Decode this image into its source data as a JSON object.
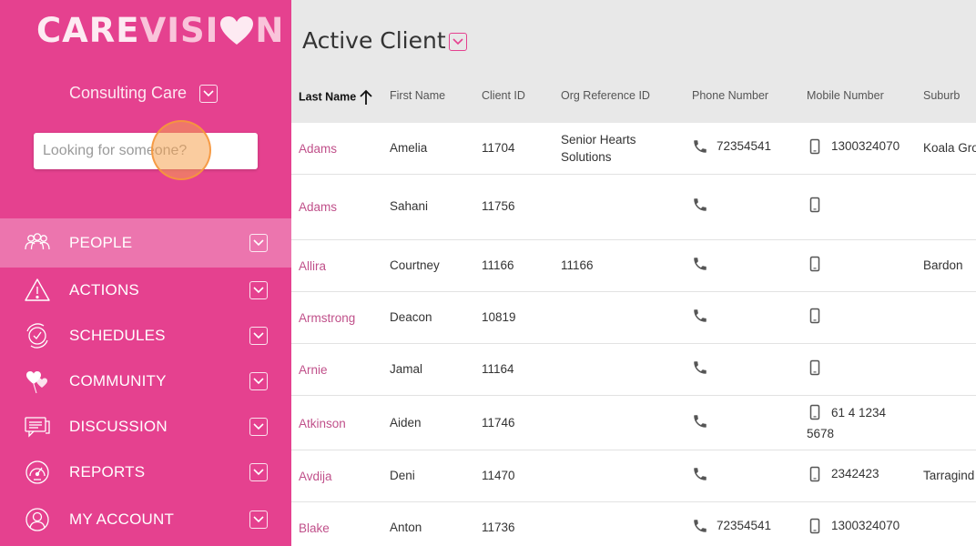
{
  "brand": {
    "care": "CARE",
    "vision": "VISI",
    "n": "N"
  },
  "org": {
    "name": "Consulting Care"
  },
  "search": {
    "placeholder": "Looking for someone?"
  },
  "nav": [
    {
      "key": "people",
      "label": "PEOPLE",
      "icon": "people-icon",
      "active": true
    },
    {
      "key": "actions",
      "label": "ACTIONS",
      "icon": "warning-icon",
      "active": false
    },
    {
      "key": "schedules",
      "label": "SCHEDULES",
      "icon": "clock-icon",
      "active": false
    },
    {
      "key": "community",
      "label": "COMMUNITY",
      "icon": "hearts-icon",
      "active": false
    },
    {
      "key": "discussion",
      "label": "DISCUSSION",
      "icon": "chat-icon",
      "active": false
    },
    {
      "key": "reports",
      "label": "REPORTS",
      "icon": "gauge-icon",
      "active": false
    },
    {
      "key": "account",
      "label": "MY ACCOUNT",
      "icon": "user-icon",
      "active": false
    }
  ],
  "page": {
    "title": "Active Client"
  },
  "table": {
    "headers": {
      "last": "Last Name",
      "first": "First Name",
      "client_id": "Client ID",
      "org_ref": "Org Reference ID",
      "phone": "Phone Number",
      "mobile": "Mobile Number",
      "suburb": "Suburb"
    },
    "rows": [
      {
        "last": "Adams",
        "first": "Amelia",
        "client_id": "11704",
        "org_ref": "Senior Hearts Solutions",
        "phone": "72354541",
        "mobile": "1300324070",
        "suburb": "Koala Gro"
      },
      {
        "last": "Adams",
        "first": "Sahani",
        "client_id": "11756",
        "org_ref": "",
        "phone": "",
        "mobile": "",
        "suburb": ""
      },
      {
        "last": "Allira",
        "first": "Courtney",
        "client_id": "11166",
        "org_ref": "11166",
        "phone": "",
        "mobile": "",
        "suburb": "Bardon"
      },
      {
        "last": "Armstrong",
        "first": "Deacon",
        "client_id": "10819",
        "org_ref": "",
        "phone": "",
        "mobile": "",
        "suburb": ""
      },
      {
        "last": "Arnie",
        "first": "Jamal",
        "client_id": "11164",
        "org_ref": "",
        "phone": "",
        "mobile": "",
        "suburb": ""
      },
      {
        "last": "Atkinson",
        "first": "Aiden",
        "client_id": "11746",
        "org_ref": "",
        "phone": "",
        "mobile": "61 4 1234 5678",
        "suburb": ""
      },
      {
        "last": "Avdija",
        "first": "Deni",
        "client_id": "11470",
        "org_ref": "",
        "phone": "",
        "mobile": "2342423",
        "suburb": "Tarragind"
      },
      {
        "last": "Blake",
        "first": "Anton",
        "client_id": "11736",
        "org_ref": "",
        "phone": "72354541",
        "mobile": "1300324070",
        "suburb": ""
      }
    ]
  },
  "colors": {
    "brand_pink": "#e5418f",
    "link_pink": "#c0508a",
    "header_gray": "#e8e8e8"
  }
}
